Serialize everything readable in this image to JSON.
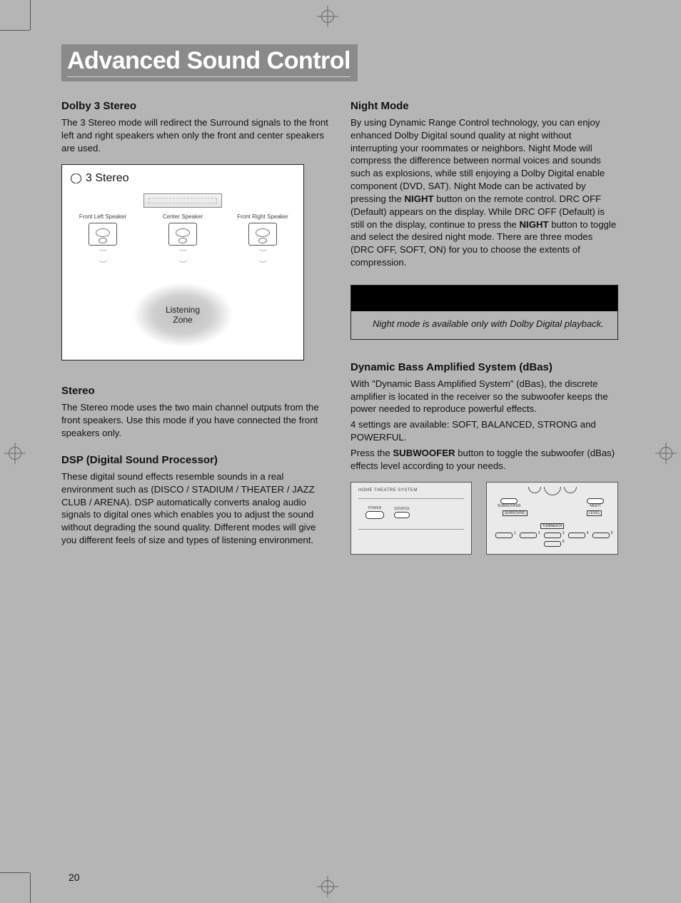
{
  "page_number": "20",
  "title": "Advanced Sound Control",
  "left": {
    "dolby3_heading": "Dolby 3 Stereo",
    "dolby3_body": "The 3 Stereo mode will redirect the Surround signals to the front left and right speakers when only the front and center speakers are used.",
    "figure": {
      "title": "3 Stereo",
      "fl": "Front Left Speaker",
      "c": "Center Speaker",
      "fr": "Front Right Speaker",
      "zone_l1": "Listening",
      "zone_l2": "Zone"
    },
    "stereo_heading": "Stereo",
    "stereo_body": "The Stereo mode uses the two main channel outputs from the front speakers. Use this mode if you have connected the front speakers only.",
    "dsp_heading": "DSP (Digital Sound Processor)",
    "dsp_body": "These digital sound effects resemble sounds in a real environment such as (DISCO / STADIUM / THEATER / JAZZ CLUB / ARENA). DSP automatically converts analog audio signals to digital ones which enables you to adjust the sound without degrading the sound quality. Different modes will give you different feels of size and types of listening environment."
  },
  "right": {
    "night_heading": "Night Mode",
    "night_p1a": "By using Dynamic Range Control technology, you can enjoy enhanced Dolby Digital sound quality at night without interrupting your roommates or neighbors. Night Mode will compress the difference between normal voices and sounds such as explosions, while still enjoying a Dolby Digital enable component (DVD, SAT). Night Mode can be activated by pressing the ",
    "night_bold1": "NIGHT",
    "night_p1b": " button on the remote control. DRC OFF (Default) appears on the display.  While DRC OFF (Default) is still on the display, continue to press the ",
    "night_bold2": "NIGHT",
    "night_p1c": " button to toggle and select the desired night mode. There are three modes (DRC OFF, SOFT, ON) for you to choose the extents of compression.",
    "note_body": "Night mode is available only with Dolby Digital playback.",
    "dbas_heading": "Dynamic Bass Amplified System (dBas)",
    "dbas_p1": "With \"Dynamic Bass Amplified System\" (dBas), the discrete amplifier is located in the receiver so the subwoofer keeps the power needed to reproduce powerful effects.",
    "dbas_p2": "4 settings are available: SOFT, BALANCED, STRONG and POWERFUL.",
    "dbas_p3a": "Press the ",
    "dbas_bold": "SUBWOOFER",
    "dbas_p3b": " button to toggle the subwoofer (dBas) effects level according to your needs.",
    "receiver_title": "HOME THEATRE SYSTEM",
    "btn_power": "POWER",
    "btn_source": "SOURCE",
    "remote_subwoofer": "SUBWOOFER",
    "remote_night": "NIGHT",
    "remote_surround": "SURROUND",
    "remote_level": "LEVEL",
    "remote_tuning": "TUNING/CH"
  }
}
